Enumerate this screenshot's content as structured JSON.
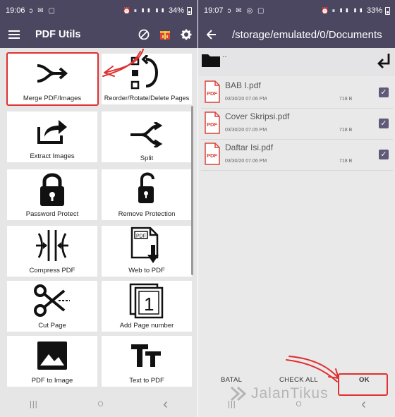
{
  "left": {
    "status": {
      "time": "19:06",
      "battery": "34%",
      "signal_icons": "📶"
    },
    "appbar": {
      "title": "PDF Utils",
      "menu_icon": "hamburger-icon",
      "block_icon": "block-icon",
      "gift_icon": "gift-icon",
      "settings_icon": "gear-icon"
    },
    "tiles": [
      {
        "label": "Merge PDF/Images",
        "icon": "merge-icon"
      },
      {
        "label": "Reorder/Rotate/Delete Pages",
        "icon": "reorder-icon"
      },
      {
        "label": "Extract Images",
        "icon": "share-icon"
      },
      {
        "label": "Split",
        "icon": "split-icon"
      },
      {
        "label": "Password Protect",
        "icon": "lock-icon"
      },
      {
        "label": "Remove Protection",
        "icon": "unlock-icon"
      },
      {
        "label": "Compress PDF",
        "icon": "compress-icon"
      },
      {
        "label": "Web to PDF",
        "icon": "web-to-pdf-icon"
      },
      {
        "label": "Cut Page",
        "icon": "scissors-icon"
      },
      {
        "label": "Add Page number",
        "icon": "page-number-icon"
      },
      {
        "label": "PDF to Image",
        "icon": "image-icon"
      },
      {
        "label": "Text to PDF",
        "icon": "text-icon"
      }
    ],
    "page_number_glyph": "1",
    "pdf_glyph": "PDF",
    "text_glyph": "TT"
  },
  "right": {
    "status": {
      "time": "19:07",
      "battery": "33%"
    },
    "appbar": {
      "path": "/storage/emulated/0/Documents",
      "back_icon": "arrow-left-icon"
    },
    "folder": {
      "label": "..",
      "up_icon": "return-arrow-icon"
    },
    "files": [
      {
        "name": "BAB I.pdf",
        "date": "03/30/20 07.06 PM",
        "size": "718 B",
        "checked": true
      },
      {
        "name": "Cover Skripsi.pdf",
        "date": "03/30/20 07.05 PM",
        "size": "718 B",
        "checked": true
      },
      {
        "name": "Daftar Isi.pdf",
        "date": "03/30/20 07.06 PM",
        "size": "718 B",
        "checked": true
      }
    ],
    "pdf_badge": "PDF",
    "buttons": {
      "cancel": "BATAL",
      "check_all": "CHECK ALL",
      "ok": "OK"
    }
  },
  "navbar": {
    "recents": "|||",
    "home": "○",
    "back": "‹"
  },
  "watermark": "JalanTikus",
  "colors": {
    "appbar": "#4b4760",
    "highlight": "#e03030",
    "checkbox": "#5f5a78",
    "pdf_icon": "#d9453b"
  }
}
